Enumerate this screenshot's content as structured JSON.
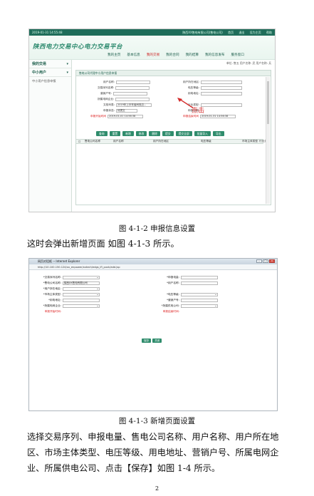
{
  "shot1": {
    "topbar_left": "2019-01-31 14:55:48",
    "topbar_right": [
      "陕西XX售电有限公司(售电公司)",
      "首页",
      "退出",
      "设为主页",
      "帮助"
    ],
    "logo": "陕西电力交易中心电力交易平台",
    "nav": [
      {
        "label": "我的主页",
        "active": false
      },
      {
        "label": "基本信息",
        "active": false
      },
      {
        "label": "我的交易",
        "active": true
      },
      {
        "label": "我的合同",
        "active": false
      },
      {
        "label": "我的结算",
        "active": false
      },
      {
        "label": "我的信息发布",
        "active": false
      },
      {
        "label": "服务窗口",
        "active": false
      }
    ],
    "user_info": "单位: 售五  用户名称: 武  用户名称: 兵",
    "sidebar": {
      "head1": "我的交易",
      "head2": "中小用户",
      "sub": "中小用户信息申报"
    },
    "panel_tab": "售电公司代理中小用户信息申报",
    "form": {
      "user_name": "用户名称:",
      "user_region": "用户所在地区:",
      "trade_seq": "交易序列名称:",
      "voltage": "电压等级:",
      "marketing_no": "营销户号:",
      "power_addr": "用电地址:",
      "grid_company": "所属电网企业:",
      "doc_list": "文档列表:",
      "doc_value": "2019年上半年省间双边…",
      "industry": "行业类型:",
      "status_label": "申报状态:",
      "status_value": "待提交",
      "report_date": "申报日期:",
      "start_label": "申报开始时间",
      "start_value": "2019-01-01 14:56:38",
      "end_label": "申报结束时间",
      "end_value": "2019-01-31 14:56:38"
    },
    "buttons": [
      "查询",
      "重置",
      "新增",
      "修改",
      "删除",
      "提交",
      "提交全部",
      "批量导入",
      "导出"
    ],
    "table_headers": [
      "售电公司名称",
      "用户名称",
      "用户所在地区",
      "电压等级",
      "市场主体类型",
      "行业类别"
    ],
    "click_label": "点击"
  },
  "caption1": "图 4-1-2 申报信息设置",
  "para1": "这时会弹出新增页面 如图 4-1-3 所示。",
  "shot2": {
    "window_title": "网页对话框 -- Internet Explorer",
    "address": "http://10.100.150.124/xx_enpower/xxtech/edgs_ifl_push/add.jsp",
    "left_fields": [
      {
        "label": "*交易序列名称:",
        "value": "",
        "select": true,
        "red": false
      },
      {
        "label": "*售电公司名称:",
        "value": "陕西XX售电有限公司",
        "select": false,
        "red": false
      },
      {
        "label": "*用户所在地区:",
        "value": "",
        "select": true,
        "red": false
      },
      {
        "label": "*市场主体类型:",
        "value": "",
        "select": true,
        "red": false
      },
      {
        "label": "*用电地址:",
        "value": "",
        "select": false,
        "red": false
      },
      {
        "label": "*所属电网企业:",
        "value": "",
        "select": true,
        "red": false
      },
      {
        "label": "申报开始时间:",
        "value": "",
        "select": false,
        "red": true
      }
    ],
    "right_fields": [
      {
        "label": "*申报电量:",
        "value": "",
        "select": false,
        "red": false
      },
      {
        "label": "*用户名称:",
        "value": "",
        "select": false,
        "red": false
      },
      {
        "label": "",
        "value": "",
        "select": false,
        "red": false
      },
      {
        "label": "*电压等级:",
        "value": "",
        "select": true,
        "red": false
      },
      {
        "label": "*营销户号:",
        "value": "",
        "select": false,
        "red": false
      },
      {
        "label": "*所属供电公司:",
        "value": "",
        "select": true,
        "red": false
      },
      {
        "label": "申报结束时间:",
        "value": "",
        "select": false,
        "red": true
      }
    ],
    "save_label": "保存",
    "close_label": "关闭"
  },
  "caption2": "图 4-1-3 新增页面设置",
  "para2": "选择交易序列、申报电量、售电公司名称、用户名称、用户所在地区、市场主体类型、电压等级、用电地址、营销户号、所属电网企业、所属供电公司、点击【保存】如图 1-4 所示。",
  "page_number": "2"
}
